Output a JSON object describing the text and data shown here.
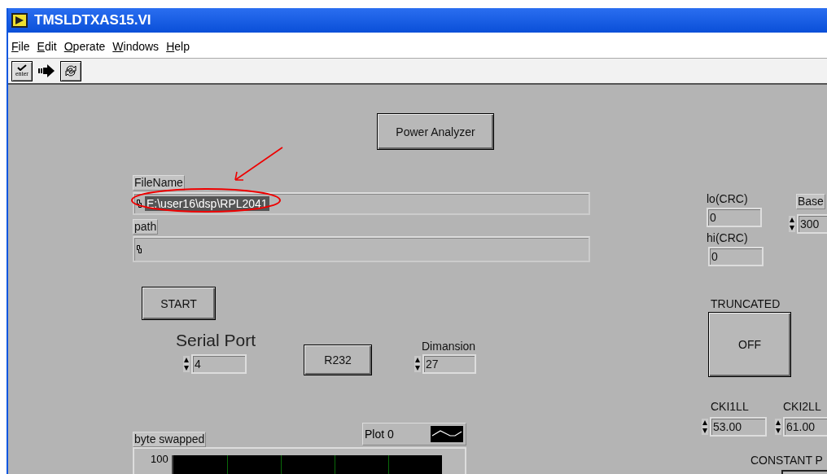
{
  "window": {
    "title": "TMSLDTXAS15.VI"
  },
  "menu": [
    "File",
    "Edit",
    "Operate",
    "Windows",
    "Help"
  ],
  "toolbar": {
    "enter_label": "enter"
  },
  "controls": [
    {
      "kind": "button",
      "text": "Power Analyzer"
    },
    {
      "kind": "path",
      "label": "FileName",
      "value": "E:\\user16\\dsp\\RPL2041",
      "highlighted": true
    },
    {
      "kind": "path",
      "label": "path"
    },
    {
      "kind": "button",
      "text": "START"
    },
    {
      "kind": "numeric",
      "label": "Serial Port",
      "value": "4"
    },
    {
      "kind": "button",
      "text": "R232"
    },
    {
      "kind": "numeric",
      "label": "Dimansion",
      "value": "27"
    },
    {
      "kind": "indicator",
      "label": "lo(CRC)",
      "value": "0"
    },
    {
      "kind": "indicator",
      "label": "hi(CRC)",
      "value": "0"
    },
    {
      "kind": "numeric",
      "label": "Base",
      "value": "300"
    },
    {
      "kind": "toggle",
      "label": "TRUNCATED",
      "text": "OFF"
    },
    {
      "kind": "numeric",
      "label": "CKI1LL",
      "value": "53.00"
    },
    {
      "kind": "numeric",
      "label": "CKI2LL",
      "value": "61.00"
    },
    {
      "kind": "caption",
      "label": "CONSTANT P"
    },
    {
      "kind": "graph",
      "label": "byte swapped",
      "legend": "Plot 0",
      "tick": "100"
    }
  ]
}
